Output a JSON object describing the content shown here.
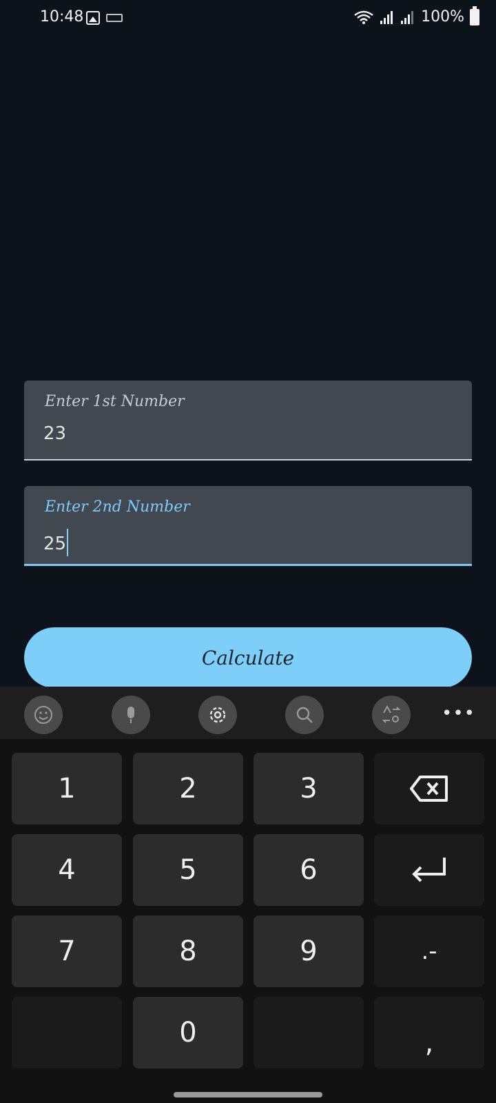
{
  "status_bar": {
    "time": "10:48",
    "battery": "100%"
  },
  "form": {
    "field1": {
      "label": "Enter 1st Number",
      "value": "23"
    },
    "field2": {
      "label": "Enter 2nd Number",
      "value": "25"
    },
    "button": "Calculate"
  },
  "keyboard": {
    "toolbar": [
      "emoji-icon",
      "mic-icon",
      "settings-icon",
      "search-icon",
      "translate-icon",
      "more-icon"
    ],
    "more_label": "•••",
    "keys": {
      "k1": "1",
      "k2": "2",
      "k3": "3",
      "k4": "4",
      "k5": "5",
      "k6": "6",
      "k7": "7",
      "k8": "8",
      "k9": "9",
      "k0": "0",
      "dot_minus": ".-",
      "comma": ","
    }
  },
  "colors": {
    "background": "#0d131a",
    "accent": "#7dcff9",
    "field": "#414850"
  }
}
